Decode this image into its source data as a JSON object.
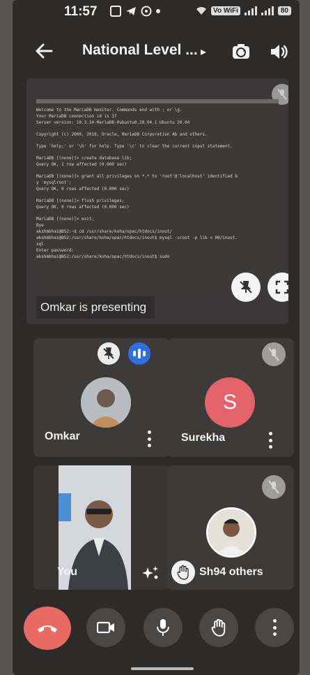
{
  "status_bar": {
    "time": "11:57",
    "network": "Vo WiFi",
    "battery": "80"
  },
  "header": {
    "title": "National Level ...",
    "back_icon": "arrow-left-icon",
    "switch_camera_icon": "switch-camera-icon",
    "speaker_icon": "speaker-icon"
  },
  "presentation": {
    "presenter_label": "Omkar is presenting",
    "terminal_lines": [
      "Welcome to the MariaDB monitor.  Commands end with ; or \\g.",
      "Your MariaDB connection id is 37",
      "Server version: 10.3.34-MariaDB-0ubuntu0.20.04.1 Ubuntu 20.04",
      "",
      "Copyright (c) 2000, 2018, Oracle, MariaDB Corporation Ab and others.",
      "",
      "Type 'help;' or '\\h' for help. Type '\\c' to clear the current input statement.",
      "",
      "MariaDB [(none)]> create database lib;",
      "Query OK, 1 row affected (0.000 sec)",
      "",
      "MariaDB [(none)]> grant all privileges on *.* to 'root'@'localhost' identified b",
      "y 'mysqlroot';",
      "Query OK, 0 rows affected (0.000 sec)",
      "",
      "MariaDB [(none)]> flush privileges;",
      "Query OK, 0 rows affected (0.000 sec)",
      "",
      "MariaDB [(none)]> exit;",
      "Bye",
      "akshmbhai@B52:~$ cd /usr/share/koha/opac/htdocs/inout/",
      "akshmbhai@B52:/usr/share/koha/opac/htdocs/inout$ mysql -uroot -p lib < 00/inout.",
      "sql",
      "Enter password:",
      "akshmbhai@B52:/usr/share/koha/opac/htdocs/inout$ sudo"
    ]
  },
  "participants": {
    "omkar": {
      "name": "Omkar"
    },
    "surekha": {
      "name": "Surekha",
      "initial": "S"
    },
    "you": {
      "name": "You"
    },
    "others": {
      "name_prefix": "Sh",
      "label": "94 others"
    }
  },
  "colors": {
    "end_call": "#e86a63",
    "audio_active": "#2f6fe0",
    "surekha_avatar": "#e4636a"
  }
}
